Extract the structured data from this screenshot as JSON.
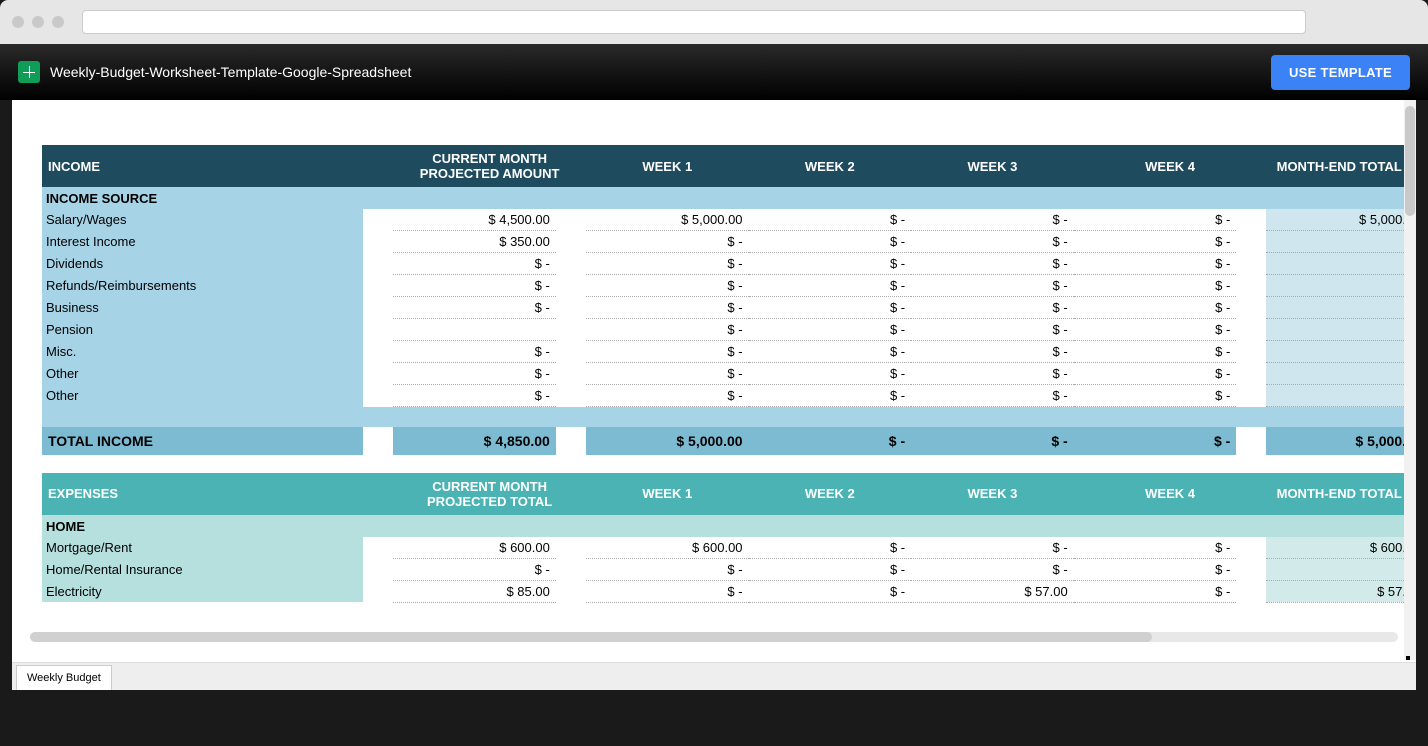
{
  "app": {
    "title": "Weekly-Budget-Worksheet-Template-Google-Spreadsheet",
    "use_template": "USE TEMPLATE",
    "sheet_tab": "Weekly Budget"
  },
  "headers": {
    "income": "INCOME",
    "expenses": "EXPENSES",
    "proj_amount": "CURRENT MONTH PROJECTED AMOUNT",
    "proj_total": "CURRENT MONTH PROJECTED TOTAL",
    "week1": "WEEK 1",
    "week2": "WEEK 2",
    "week3": "WEEK 3",
    "week4": "WEEK 4",
    "month_end": "MONTH-END TOTAL"
  },
  "income": {
    "subhead": "INCOME SOURCE",
    "rows": [
      {
        "label": "Salary/Wages",
        "proj": "$ 4,500.00",
        "w1": "$ 5,000.00",
        "w2": "$ -",
        "w3": "$ -",
        "w4": "$ -",
        "tot": "$ 5,000."
      },
      {
        "label": "Interest Income",
        "proj": "$ 350.00",
        "w1": "$ -",
        "w2": "$ -",
        "w3": "$ -",
        "w4": "$ -",
        "tot": ""
      },
      {
        "label": "Dividends",
        "proj": "$ -",
        "w1": "$ -",
        "w2": "$ -",
        "w3": "$ -",
        "w4": "$ -",
        "tot": ""
      },
      {
        "label": "Refunds/Reimbursements",
        "proj": "$ -",
        "w1": "$ -",
        "w2": "$ -",
        "w3": "$ -",
        "w4": "$ -",
        "tot": ""
      },
      {
        "label": "Business",
        "proj": "$ -",
        "w1": "$ -",
        "w2": "$ -",
        "w3": "$ -",
        "w4": "$ -",
        "tot": ""
      },
      {
        "label": "Pension",
        "proj": "",
        "w1": "$ -",
        "w2": "$ -",
        "w3": "$ -",
        "w4": "$ -",
        "tot": ""
      },
      {
        "label": "Misc.",
        "proj": "$ -",
        "w1": "$ -",
        "w2": "$ -",
        "w3": "$ -",
        "w4": "$ -",
        "tot": ""
      },
      {
        "label": "Other",
        "proj": "$ -",
        "w1": "$ -",
        "w2": "$ -",
        "w3": "$ -",
        "w4": "$ -",
        "tot": ""
      },
      {
        "label": "Other",
        "proj": "$ -",
        "w1": "$ -",
        "w2": "$ -",
        "w3": "$ -",
        "w4": "$ -",
        "tot": ""
      }
    ],
    "total": {
      "label": "TOTAL INCOME",
      "proj": "$ 4,850.00",
      "w1": "$ 5,000.00",
      "w2": "$ -",
      "w3": "$ -",
      "w4": "$ -",
      "tot": "$ 5,000."
    }
  },
  "expenses": {
    "subhead": "HOME",
    "rows": [
      {
        "label": "Mortgage/Rent",
        "proj": "$ 600.00",
        "w1": "$ 600.00",
        "w2": "$ -",
        "w3": "$ -",
        "w4": "$ -",
        "tot": "$ 600."
      },
      {
        "label": "Home/Rental Insurance",
        "proj": "$ -",
        "w1": "$ -",
        "w2": "$ -",
        "w3": "$ -",
        "w4": "$ -",
        "tot": ""
      },
      {
        "label": "Electricity",
        "proj": "$ 85.00",
        "w1": "$ -",
        "w2": "$ -",
        "w3": "$ 57.00",
        "w4": "$ -",
        "tot": "$ 57."
      }
    ]
  },
  "chart_data": {
    "type": "table",
    "title": "Weekly Budget Worksheet",
    "sections": [
      {
        "name": "INCOME",
        "columns": [
          "CURRENT MONTH PROJECTED AMOUNT",
          "WEEK 1",
          "WEEK 2",
          "WEEK 3",
          "WEEK 4",
          "MONTH-END TOTAL"
        ],
        "rows": [
          {
            "label": "Salary/Wages",
            "values": [
              4500,
              5000,
              0,
              0,
              0,
              5000
            ]
          },
          {
            "label": "Interest Income",
            "values": [
              350,
              0,
              0,
              0,
              0,
              0
            ]
          },
          {
            "label": "Dividends",
            "values": [
              0,
              0,
              0,
              0,
              0,
              0
            ]
          },
          {
            "label": "Refunds/Reimbursements",
            "values": [
              0,
              0,
              0,
              0,
              0,
              0
            ]
          },
          {
            "label": "Business",
            "values": [
              0,
              0,
              0,
              0,
              0,
              0
            ]
          },
          {
            "label": "Pension",
            "values": [
              null,
              0,
              0,
              0,
              0,
              0
            ]
          },
          {
            "label": "Misc.",
            "values": [
              0,
              0,
              0,
              0,
              0,
              0
            ]
          },
          {
            "label": "Other",
            "values": [
              0,
              0,
              0,
              0,
              0,
              0
            ]
          },
          {
            "label": "Other",
            "values": [
              0,
              0,
              0,
              0,
              0,
              0
            ]
          }
        ],
        "total": {
          "label": "TOTAL INCOME",
          "values": [
            4850,
            5000,
            0,
            0,
            0,
            5000
          ]
        }
      },
      {
        "name": "EXPENSES / HOME",
        "columns": [
          "CURRENT MONTH PROJECTED TOTAL",
          "WEEK 1",
          "WEEK 2",
          "WEEK 3",
          "WEEK 4",
          "MONTH-END TOTAL"
        ],
        "rows": [
          {
            "label": "Mortgage/Rent",
            "values": [
              600,
              600,
              0,
              0,
              0,
              600
            ]
          },
          {
            "label": "Home/Rental Insurance",
            "values": [
              0,
              0,
              0,
              0,
              0,
              0
            ]
          },
          {
            "label": "Electricity",
            "values": [
              85,
              0,
              0,
              57,
              0,
              57
            ]
          }
        ]
      }
    ]
  }
}
